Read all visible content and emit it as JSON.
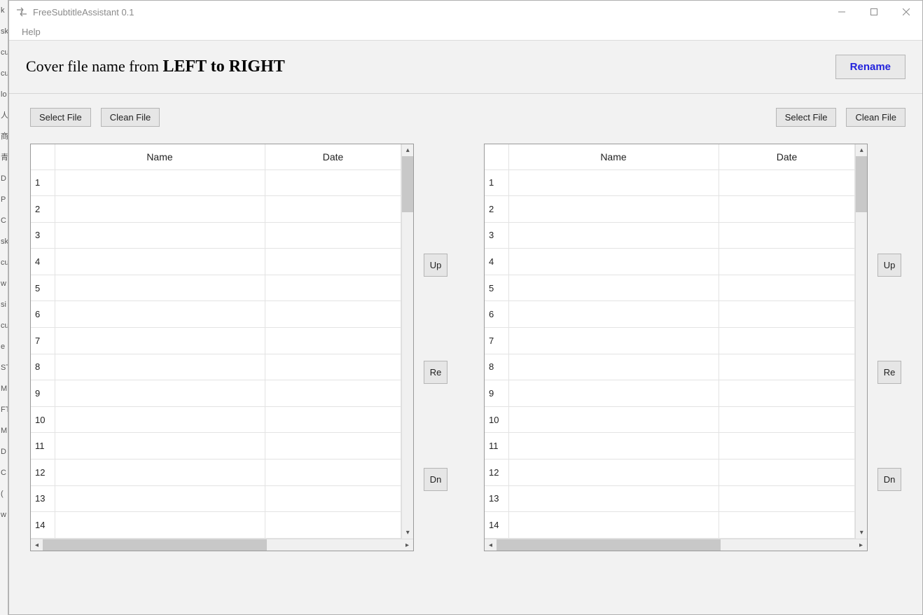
{
  "desktop_labels": [
    "k",
    "sk",
    "cu",
    "cu",
    "lo",
    "人",
    "商",
    "青",
    "D",
    "P",
    "C",
    "sk",
    "cu",
    "w",
    "si",
    "cu",
    "e",
    "ST",
    "M",
    "FT",
    "M",
    "D",
    "C",
    "(",
    "w"
  ],
  "titlebar": {
    "title": "FreeSubtitleAssistant 0.1"
  },
  "menubar": {
    "items": [
      "Help"
    ]
  },
  "header": {
    "prefix": "Cover file name from ",
    "bold": "LEFT to RIGHT",
    "rename_label": "Rename"
  },
  "toolbar": {
    "select_file": "Select File",
    "clean_file": "Clean File"
  },
  "columns": {
    "name": "Name",
    "date": "Date"
  },
  "left_table": {
    "rows": [
      {
        "n": "1",
        "name": "",
        "date": ""
      },
      {
        "n": "2",
        "name": "",
        "date": ""
      },
      {
        "n": "3",
        "name": "",
        "date": ""
      },
      {
        "n": "4",
        "name": "",
        "date": ""
      },
      {
        "n": "5",
        "name": "",
        "date": ""
      },
      {
        "n": "6",
        "name": "",
        "date": ""
      },
      {
        "n": "7",
        "name": "",
        "date": ""
      },
      {
        "n": "8",
        "name": "",
        "date": ""
      },
      {
        "n": "9",
        "name": "",
        "date": ""
      },
      {
        "n": "10",
        "name": "",
        "date": ""
      },
      {
        "n": "11",
        "name": "",
        "date": ""
      },
      {
        "n": "12",
        "name": "",
        "date": ""
      },
      {
        "n": "13",
        "name": "",
        "date": ""
      },
      {
        "n": "14",
        "name": "",
        "date": ""
      }
    ]
  },
  "right_table": {
    "rows": [
      {
        "n": "1",
        "name": "",
        "date": ""
      },
      {
        "n": "2",
        "name": "",
        "date": ""
      },
      {
        "n": "3",
        "name": "",
        "date": ""
      },
      {
        "n": "4",
        "name": "",
        "date": ""
      },
      {
        "n": "5",
        "name": "",
        "date": ""
      },
      {
        "n": "6",
        "name": "",
        "date": ""
      },
      {
        "n": "7",
        "name": "",
        "date": ""
      },
      {
        "n": "8",
        "name": "",
        "date": ""
      },
      {
        "n": "9",
        "name": "",
        "date": ""
      },
      {
        "n": "10",
        "name": "",
        "date": ""
      },
      {
        "n": "11",
        "name": "",
        "date": ""
      },
      {
        "n": "12",
        "name": "",
        "date": ""
      },
      {
        "n": "13",
        "name": "",
        "date": ""
      },
      {
        "n": "14",
        "name": "",
        "date": ""
      }
    ]
  },
  "side_buttons": {
    "up": "Up",
    "re": "Re",
    "dn": "Dn"
  }
}
